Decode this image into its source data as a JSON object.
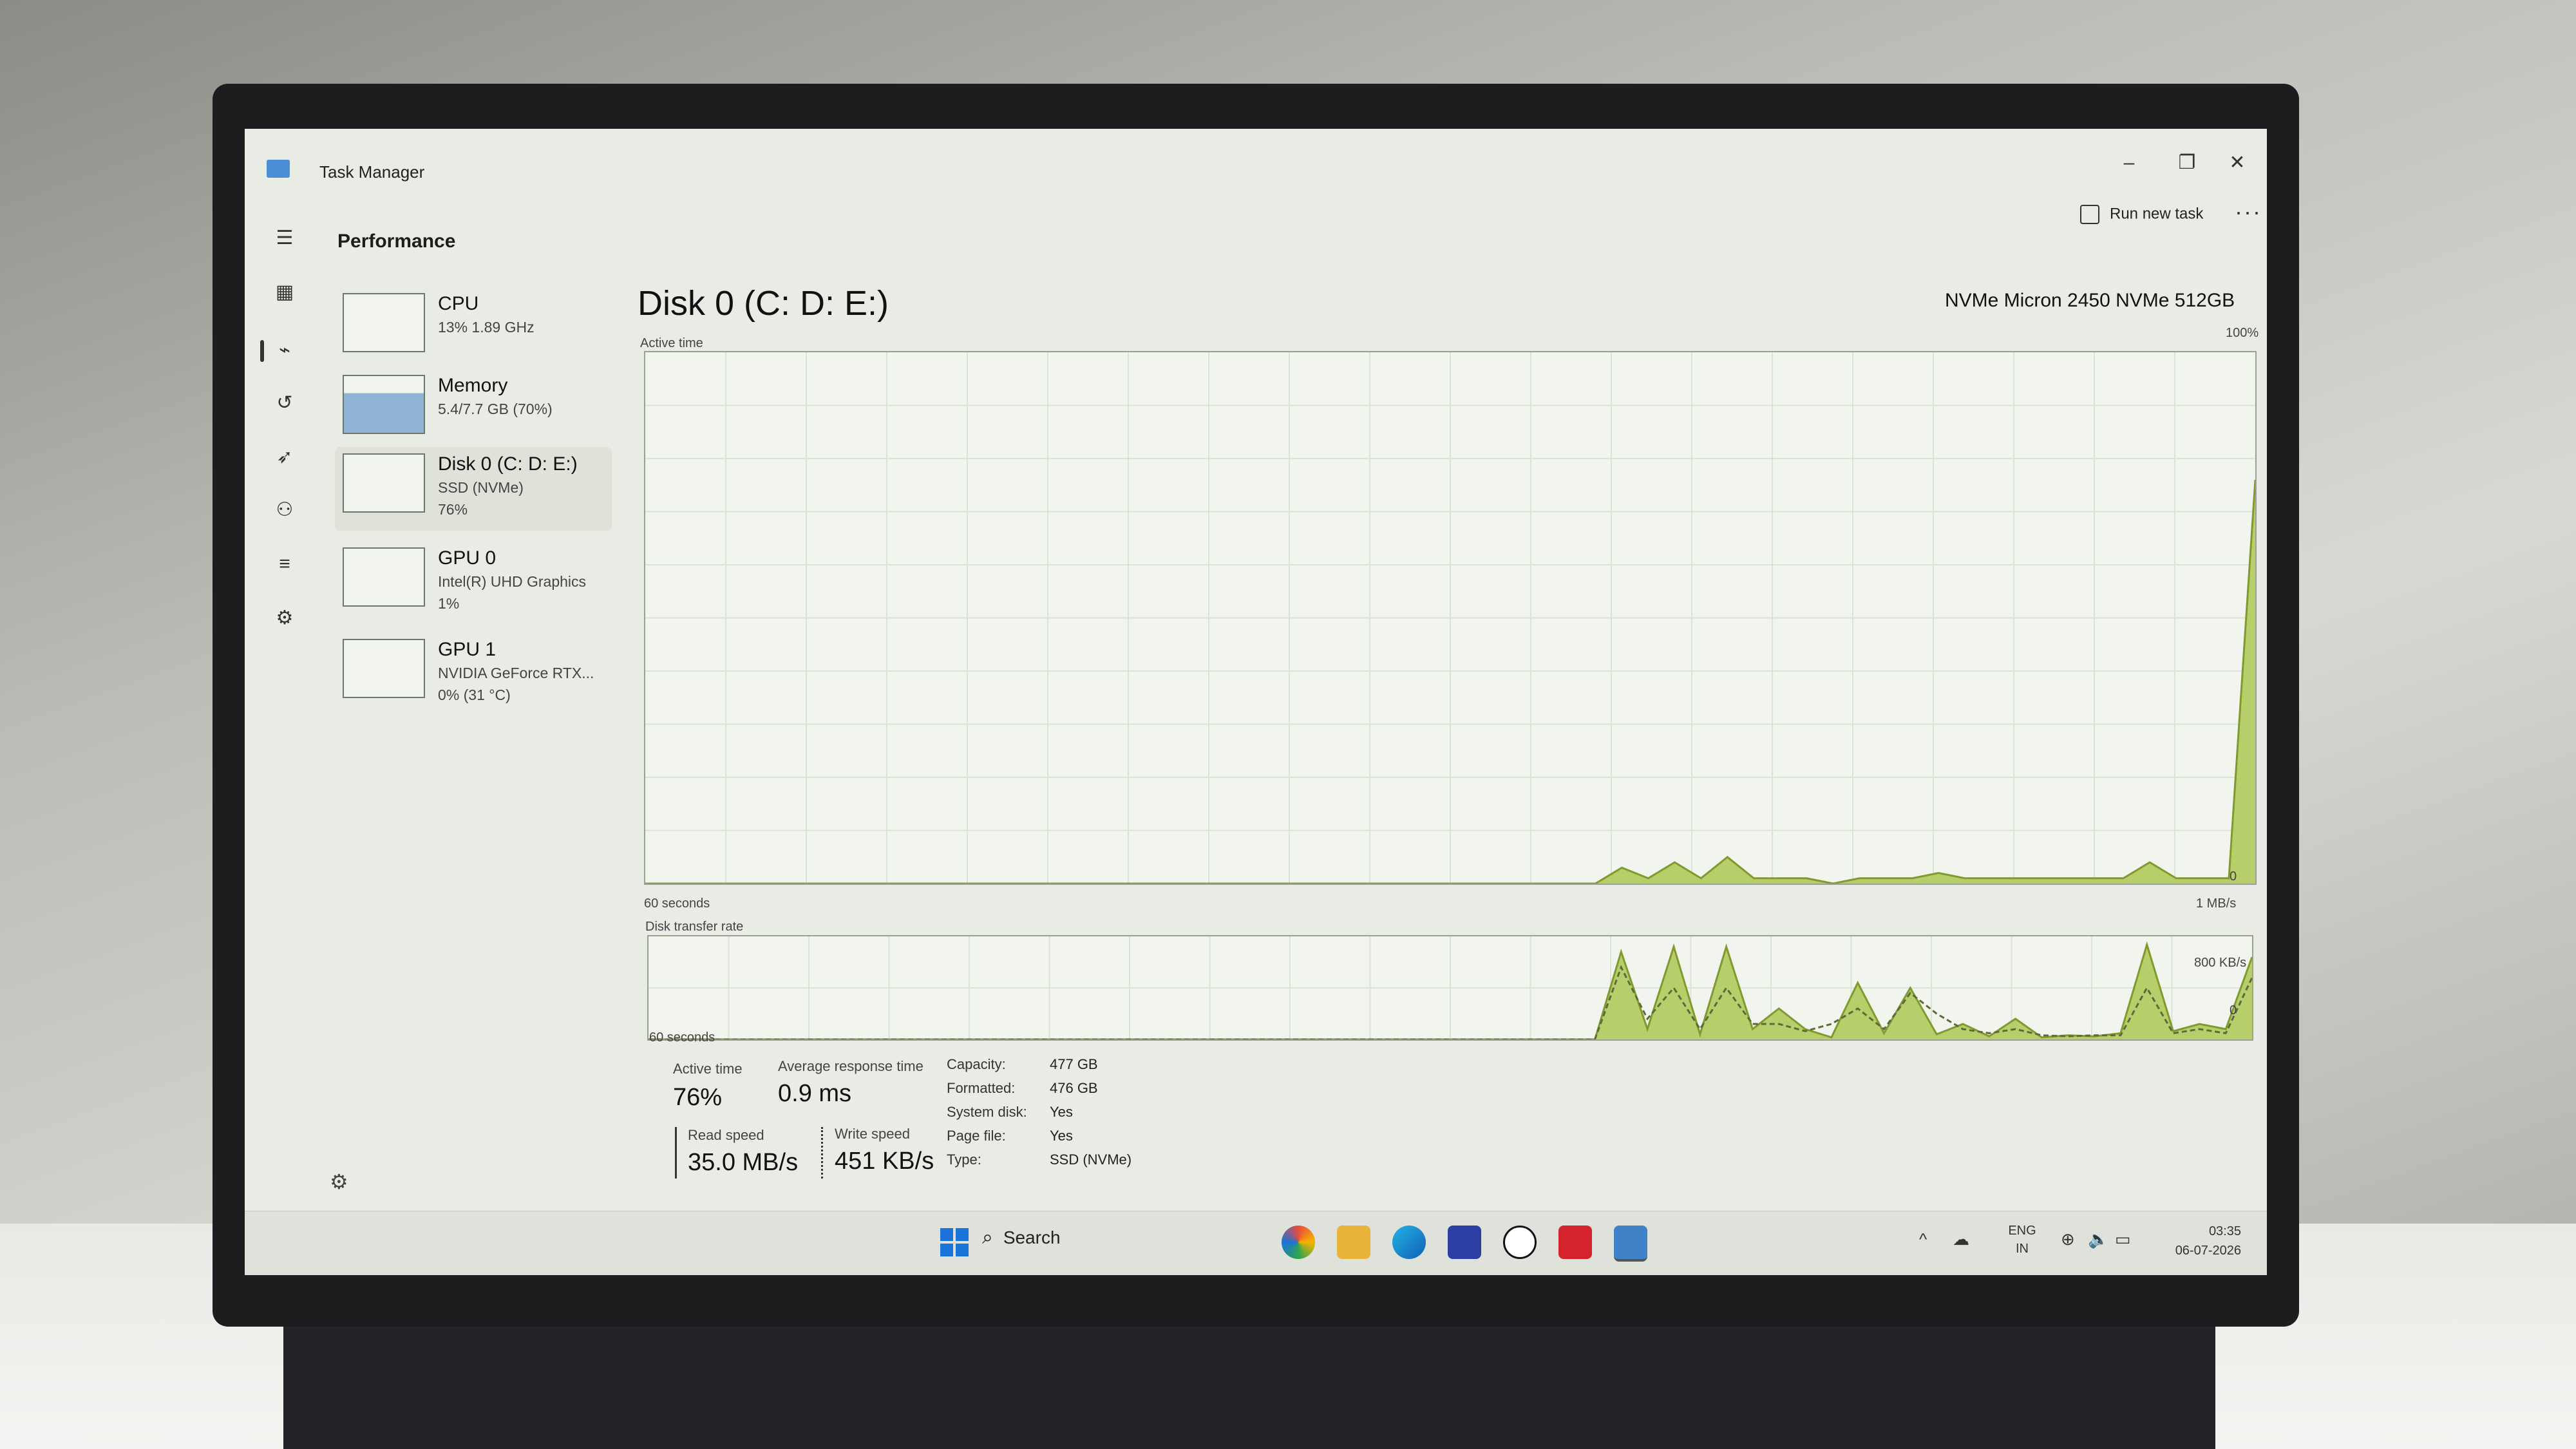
{
  "window": {
    "title": "Task Manager"
  },
  "header": {
    "title": "Performance",
    "run_new_task": "Run new task",
    "more": "···"
  },
  "devices": [
    {
      "name": "CPU",
      "sub1": "13% 1.89 GHz",
      "sub2": ""
    },
    {
      "name": "Memory",
      "sub1": "5.4/7.7 GB (70%)",
      "sub2": ""
    },
    {
      "name": "Disk 0 (C: D: E:)",
      "sub1": "SSD (NVMe)",
      "sub2": "76%"
    },
    {
      "name": "GPU 0",
      "sub1": "Intel(R) UHD Graphics",
      "sub2": "1%"
    },
    {
      "name": "GPU 1",
      "sub1": "NVIDIA GeForce RTX...",
      "sub2": "0% (31 °C)"
    }
  ],
  "main": {
    "title": "Disk 0 (C: D: E:)",
    "model": "NVMe Micron 2450 NVMe 512GB",
    "graph1": {
      "label": "Active time",
      "max": "100%",
      "min": "0",
      "xlabel": "60 seconds",
      "right_label": "1 MB/s"
    },
    "graph2": {
      "label": "Disk transfer rate",
      "inner_label": "800 KB/s",
      "min": "0",
      "xlabel": "60 seconds"
    }
  },
  "stats": {
    "active_time_label": "Active time",
    "active_time_value": "76%",
    "avg_resp_label": "Average response time",
    "avg_resp_value": "0.9 ms",
    "read_label": "Read speed",
    "read_value": "35.0 MB/s",
    "write_label": "Write speed",
    "write_value": "451 KB/s"
  },
  "props": [
    {
      "k": "Capacity:",
      "v": "477 GB"
    },
    {
      "k": "Formatted:",
      "v": "476 GB"
    },
    {
      "k": "System disk:",
      "v": "Yes"
    },
    {
      "k": "Page file:",
      "v": "Yes"
    },
    {
      "k": "Type:",
      "v": "SSD (NVMe)"
    }
  ],
  "taskbar": {
    "search": "Search",
    "lang1": "ENG",
    "lang2": "IN",
    "time": "03:35",
    "date": "06-07-2026"
  },
  "chart_data": [
    {
      "type": "area",
      "title": "Active time",
      "x_range": [
        60,
        0
      ],
      "ylim": [
        0,
        100
      ],
      "y_unit": "%",
      "series": [
        {
          "values": [
            0,
            0,
            0,
            0,
            0,
            0,
            0,
            0,
            0,
            0,
            0,
            0,
            0,
            0,
            0,
            0,
            0,
            0,
            0,
            0,
            0,
            0,
            0,
            0,
            0,
            0,
            0,
            0,
            0,
            0,
            0,
            0,
            0,
            0,
            0,
            0,
            0,
            3,
            1,
            4,
            1,
            5,
            1,
            1,
            1,
            0,
            1,
            1,
            1,
            2,
            1,
            1,
            1,
            1,
            1,
            1,
            1,
            4,
            1,
            1,
            1,
            76
          ]
        }
      ]
    },
    {
      "type": "line",
      "title": "Disk transfer rate",
      "x_range": [
        60,
        0
      ],
      "y_unit": "KB/s",
      "ylim": [
        0,
        1000
      ],
      "series": [
        {
          "values": [
            0,
            0,
            0,
            0,
            0,
            0,
            0,
            0,
            0,
            0,
            0,
            0,
            0,
            0,
            0,
            0,
            0,
            0,
            0,
            0,
            0,
            0,
            0,
            0,
            0,
            0,
            0,
            0,
            0,
            0,
            0,
            0,
            0,
            0,
            0,
            0,
            0,
            850,
            100,
            900,
            50,
            900,
            100,
            300,
            100,
            20,
            550,
            60,
            500,
            50,
            150,
            30,
            200,
            20,
            40,
            30,
            60,
            920,
            80,
            150,
            100,
            800
          ]
        },
        {
          "values": [
            0,
            0,
            0,
            0,
            0,
            0,
            0,
            0,
            0,
            0,
            0,
            0,
            0,
            0,
            0,
            0,
            0,
            0,
            0,
            0,
            0,
            0,
            0,
            0,
            0,
            0,
            0,
            0,
            0,
            0,
            0,
            0,
            0,
            0,
            0,
            0,
            0,
            700,
            200,
            500,
            100,
            500,
            150,
            150,
            80,
            150,
            300,
            100,
            450,
            250,
            100,
            60,
            100,
            40,
            30,
            40,
            40,
            500,
            60,
            100,
            60,
            600
          ]
        }
      ]
    }
  ]
}
